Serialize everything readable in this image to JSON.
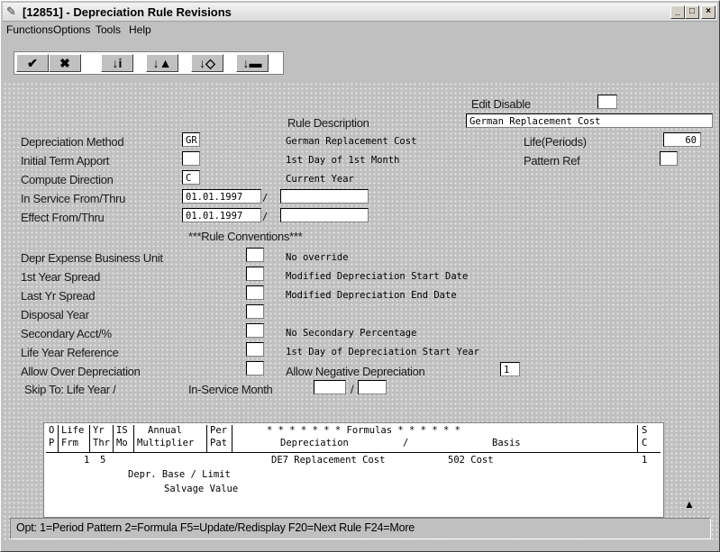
{
  "window": {
    "title": "[12851] - Depreciation Rule Revisions",
    "controls": {
      "minimize": "_",
      "maximize": "□",
      "close": "×"
    }
  },
  "menu": [
    "Functions",
    "Options",
    "Tools",
    "Help"
  ],
  "toolbar": {
    "buttons": [
      {
        "name": "ok",
        "glyph": "✔"
      },
      {
        "name": "cancel",
        "glyph": "✖"
      },
      {
        "name": "find",
        "glyph": "↓i"
      },
      {
        "name": "add",
        "glyph": "↓▲"
      },
      {
        "name": "copy",
        "glyph": "↓◇"
      },
      {
        "name": "delete",
        "glyph": "↓▬"
      }
    ]
  },
  "form": {
    "edit_disable_label": "Edit Disable",
    "rule_description_label": "Rule Description",
    "rule_description_value": "German Replacement Cost",
    "depreciation_method_label": "Depreciation Method",
    "depreciation_method_value": "GR",
    "depreciation_method_desc": "German Replacement Cost",
    "life_periods_label": "Life(Periods)",
    "life_periods_value": "60",
    "initial_term_label": "Initial Term Apport",
    "initial_term_desc": "1st Day of 1st Month",
    "pattern_ref_label": "Pattern Ref",
    "compute_direction_label": "Compute Direction",
    "compute_direction_value": "C",
    "compute_direction_desc": "Current Year",
    "in_service_label": "In Service From/Thru",
    "in_service_from": "01.01.1997",
    "effect_label": "Effect From/Thru",
    "effect_from": "01.01.1997",
    "slash": "/",
    "rule_conventions": "***Rule Conventions***",
    "depr_expense_bu_label": "Depr Expense Business Unit",
    "depr_expense_bu_desc": "No override",
    "first_year_spread_label": "1st Year Spread",
    "first_year_spread_desc": "Modified Depreciation Start Date",
    "last_yr_spread_label": "Last Yr Spread",
    "last_yr_spread_desc": "Modified Depreciation End Date",
    "disposal_year_label": "Disposal Year",
    "secondary_acct_label": "Secondary Acct/%",
    "secondary_acct_desc": "No Secondary Percentage",
    "life_year_ref_label": "Life Year Reference",
    "life_year_ref_desc": "1st Day of Depreciation Start Year",
    "allow_over_label": "Allow Over Depreciation",
    "allow_negative_label": "Allow Negative Depreciation",
    "allow_negative_value": "1",
    "skip_to_label": "Skip To: Life Year /",
    "in_service_month_label": "In-Service Month"
  },
  "grid": {
    "headers": {
      "op": [
        "O",
        "P"
      ],
      "life": [
        "Life",
        "Frm"
      ],
      "yr": [
        "Yr",
        "Thr"
      ],
      "is": [
        "IS",
        "Mo"
      ],
      "annual": [
        "Annual",
        "Multiplier"
      ],
      "per": [
        "Per",
        "Pat"
      ],
      "formulas": "* * * * * * * Formulas * * * * * *",
      "depreciation": "Depreciation",
      "basis": "Basis",
      "sc": [
        "S",
        "C"
      ]
    },
    "row": {
      "life_frm": "1",
      "yr_thr": "5",
      "depreciation": "DE7 Replacement Cost",
      "basis": "502 Cost",
      "sc": "1",
      "sub1": "Depr. Base / Limit",
      "sub2": "Salvage Value"
    }
  },
  "status": "Opt: 1=Period Pattern 2=Formula F5=Update/Redisplay F20=Next Rule F24=More",
  "scroll": {
    "up": "▲",
    "down": "▼"
  }
}
